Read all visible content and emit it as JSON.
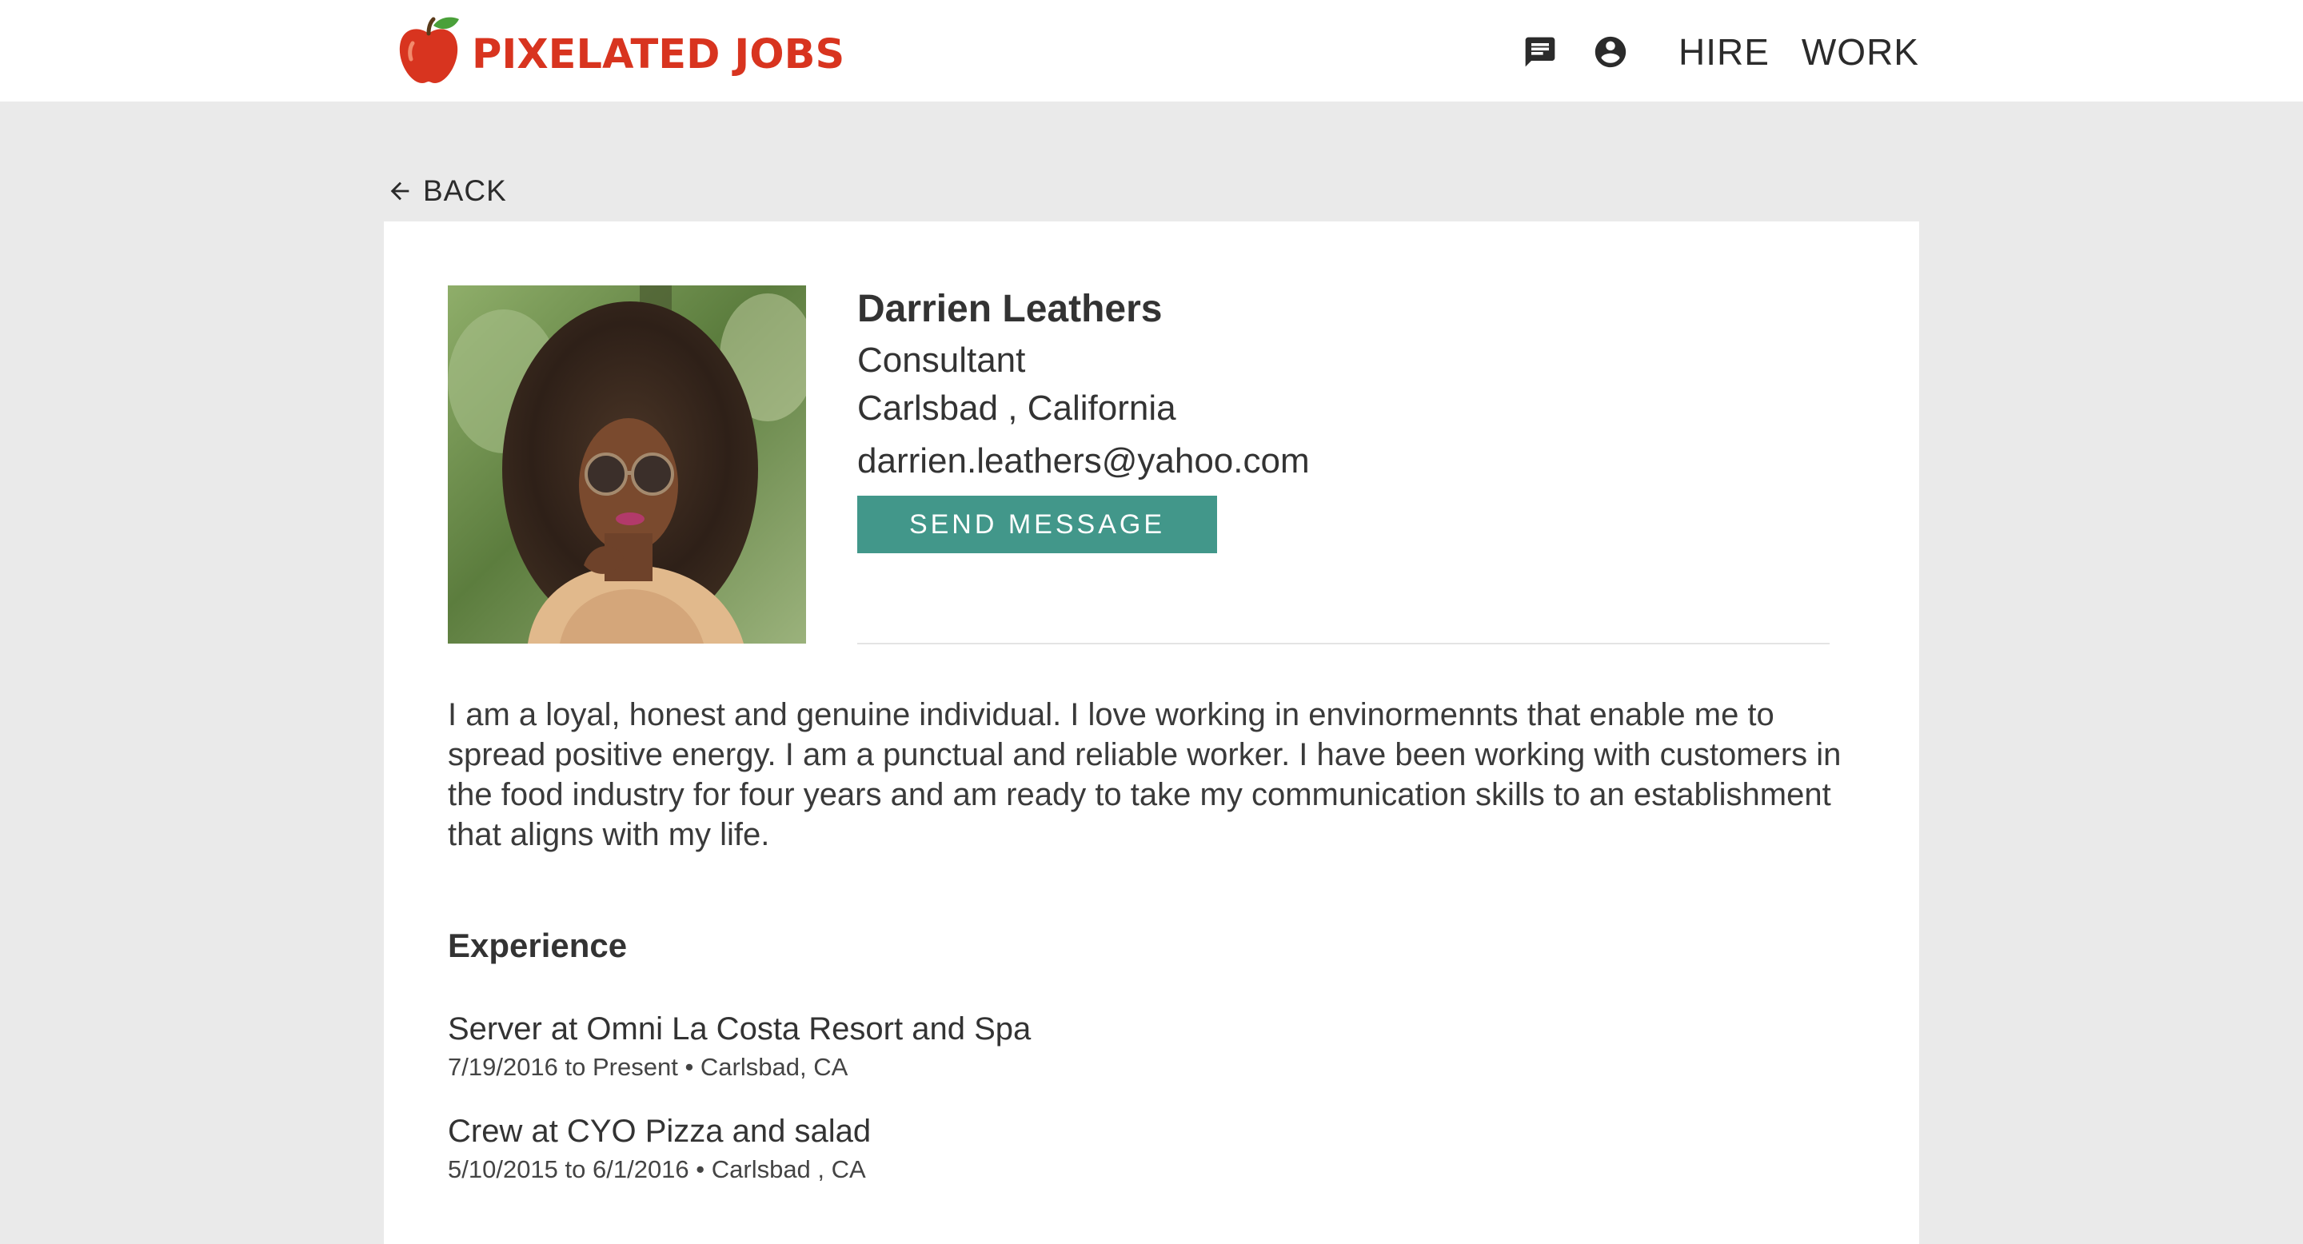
{
  "header": {
    "logo_text": "PIXELATED JOBS",
    "nav": {
      "messages_icon": "chat-icon",
      "account_icon": "account-circle-icon",
      "hire_label": "HIRE",
      "work_label": "WORK"
    }
  },
  "back": {
    "label": "BACK",
    "icon": "arrow-left-icon"
  },
  "profile": {
    "name": "Darrien Leathers",
    "title": "Consultant",
    "location": "Carlsbad , California",
    "email": "darrien.leathers@yahoo.com",
    "send_message_label": "SEND MESSAGE",
    "bio": "I am a loyal, honest and genuine individual. I love working in envinormennts that enable me to spread positive energy. I am  a punctual and reliable worker. I have been working with customers in the food industry for four years and am ready to take my communication skills to an establishment that aligns with my life."
  },
  "experience": {
    "heading": "Experience",
    "items": [
      {
        "role": "Server at Omni La Costa Resort and Spa",
        "meta": "7/19/2016 to Present • Carlsbad, CA"
      },
      {
        "role": "Crew at CYO Pizza and salad",
        "meta": "5/10/2015 to 6/1/2016 • Carlsbad , CA"
      }
    ]
  },
  "colors": {
    "brand_red": "#d8341f",
    "button_teal": "#42978a",
    "page_bg": "#eaeaea"
  }
}
